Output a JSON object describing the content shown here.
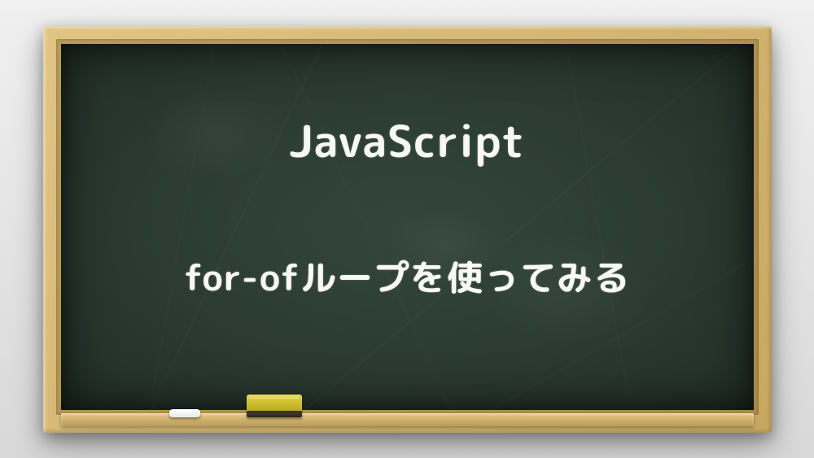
{
  "board": {
    "title": "JavaScript",
    "subtitle": "for-ofループを使ってみる"
  }
}
